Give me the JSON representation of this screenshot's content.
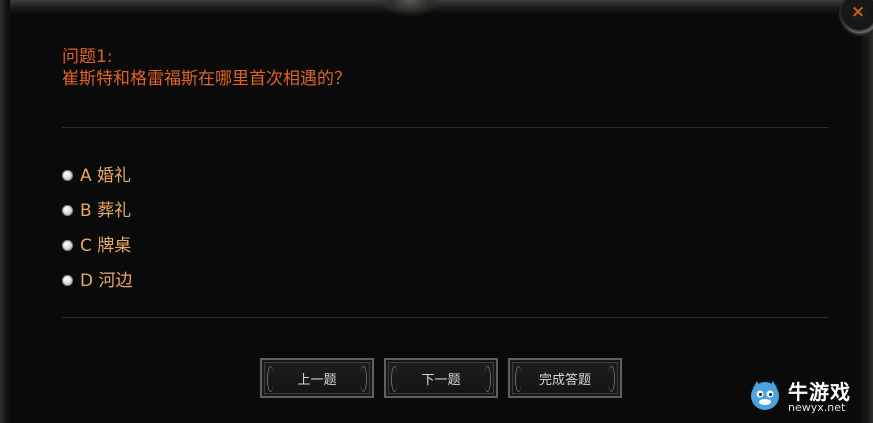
{
  "dialog": {
    "close_label": "×"
  },
  "question": {
    "label": "问题1:",
    "text": "崔斯特和格雷福斯在哪里首次相遇的？"
  },
  "options": [
    {
      "letter": "A",
      "label": "A 婚礼"
    },
    {
      "letter": "B",
      "label": "B 葬礼"
    },
    {
      "letter": "C",
      "label": "C 牌桌"
    },
    {
      "letter": "D",
      "label": "D 河边"
    }
  ],
  "buttons": {
    "prev_label": "上一题",
    "next_label": "下一题",
    "finish_label": "完成答题"
  },
  "watermark": {
    "name": "牛游戏",
    "url": "newyx.net"
  },
  "colors": {
    "accent": "#e0622a",
    "option_text": "#e8a968",
    "background": "#0a0a0a",
    "close_icon": "#d45a1c"
  },
  "icons": {
    "close": "close-icon",
    "radio": "radio-icon",
    "logo": "newyx-logo-icon"
  }
}
